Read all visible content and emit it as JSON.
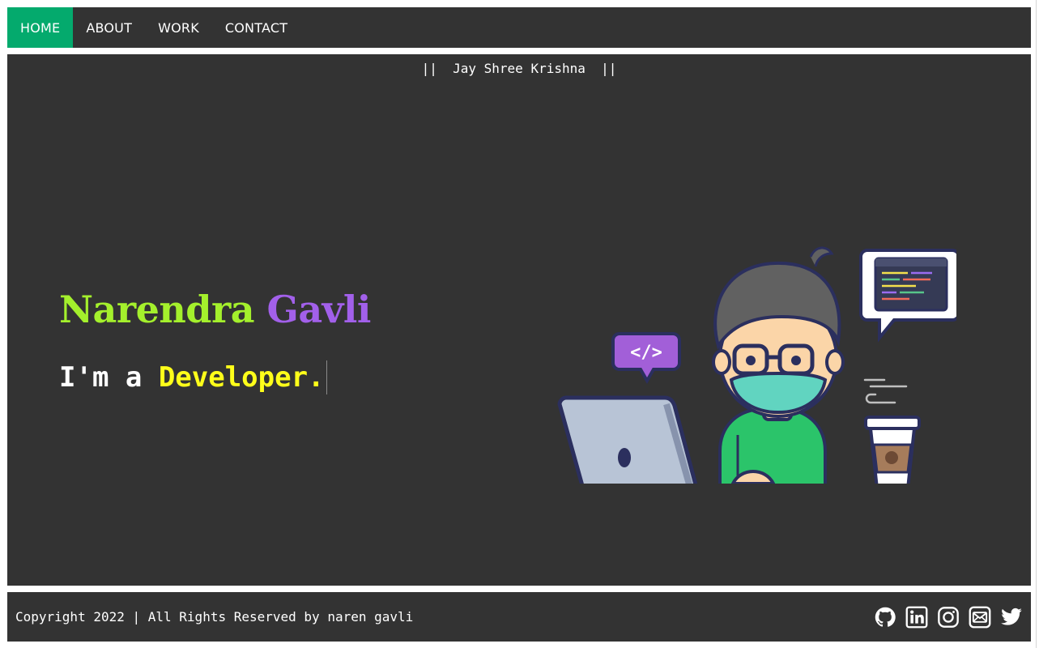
{
  "nav": {
    "items": [
      {
        "label": "HOME",
        "active": true
      },
      {
        "label": "ABOUT",
        "active": false
      },
      {
        "label": "WORK",
        "active": false
      },
      {
        "label": "CONTACT",
        "active": false
      }
    ]
  },
  "hero": {
    "tagline": "||  Jay Shree Krishna  ||",
    "first_name": "Narendra",
    "last_name": "Gavli",
    "role_prefix": "I'm a ",
    "role_highlight": "Developer.",
    "illustration": "developer-at-laptop-illustration"
  },
  "footer": {
    "copyright": "Copyright 2022 | All Rights Reserved by naren gavli",
    "socials": [
      "github-icon",
      "linkedin-icon",
      "instagram-icon",
      "mail-icon",
      "twitter-icon"
    ]
  },
  "colors": {
    "background": "#333333",
    "nav_active": "#04aa6d",
    "first_name": "#a4f02c",
    "last_name": "#a260ea",
    "role_highlight": "#ffff1a"
  }
}
